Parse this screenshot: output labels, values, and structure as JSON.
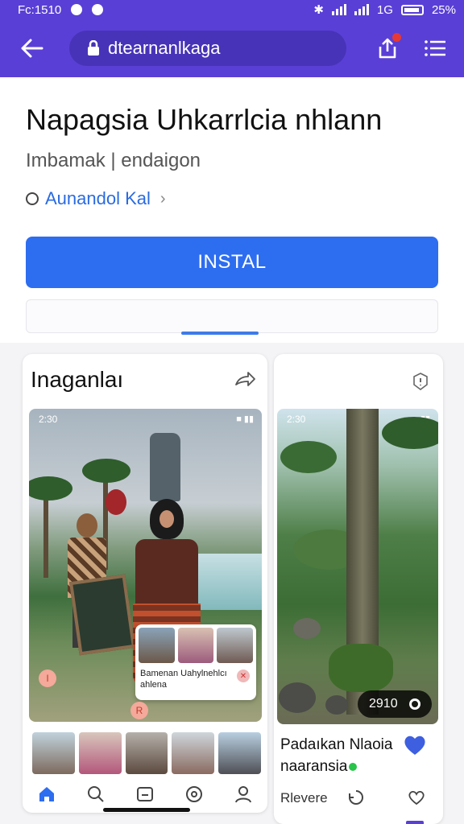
{
  "status_bar": {
    "time": "Fc:1510",
    "signal_label": "1G",
    "battery": "25%"
  },
  "toolbar": {
    "url": "dtearnanlkaga",
    "colors": {
      "brand": "#5a3fd6",
      "pill": "#4733b8"
    }
  },
  "app": {
    "title": "Napagsia Uhkarrlcia nhlann",
    "subtitle": "Imbamak | endaigon",
    "developer": "Aunandol Kal",
    "install_label": "INSTAL",
    "accent": "#2d6df0"
  },
  "screenshots": {
    "left": {
      "title": "Inaganlaı",
      "shot_time": "2:30",
      "overlay_text": "Bamenan Uahylnehlcı ahlena",
      "pin_a": "I",
      "pin_b": "R",
      "nav_icons": [
        "home-icon",
        "search-icon",
        "messages-icon",
        "explore-icon",
        "profile-icon"
      ]
    },
    "right": {
      "shot_time": "2:30",
      "counter": "2910",
      "post_title_line1": "Padaıkan Nlaoia",
      "post_title_line2": "naaransia",
      "more_label": "Rlevere"
    }
  }
}
